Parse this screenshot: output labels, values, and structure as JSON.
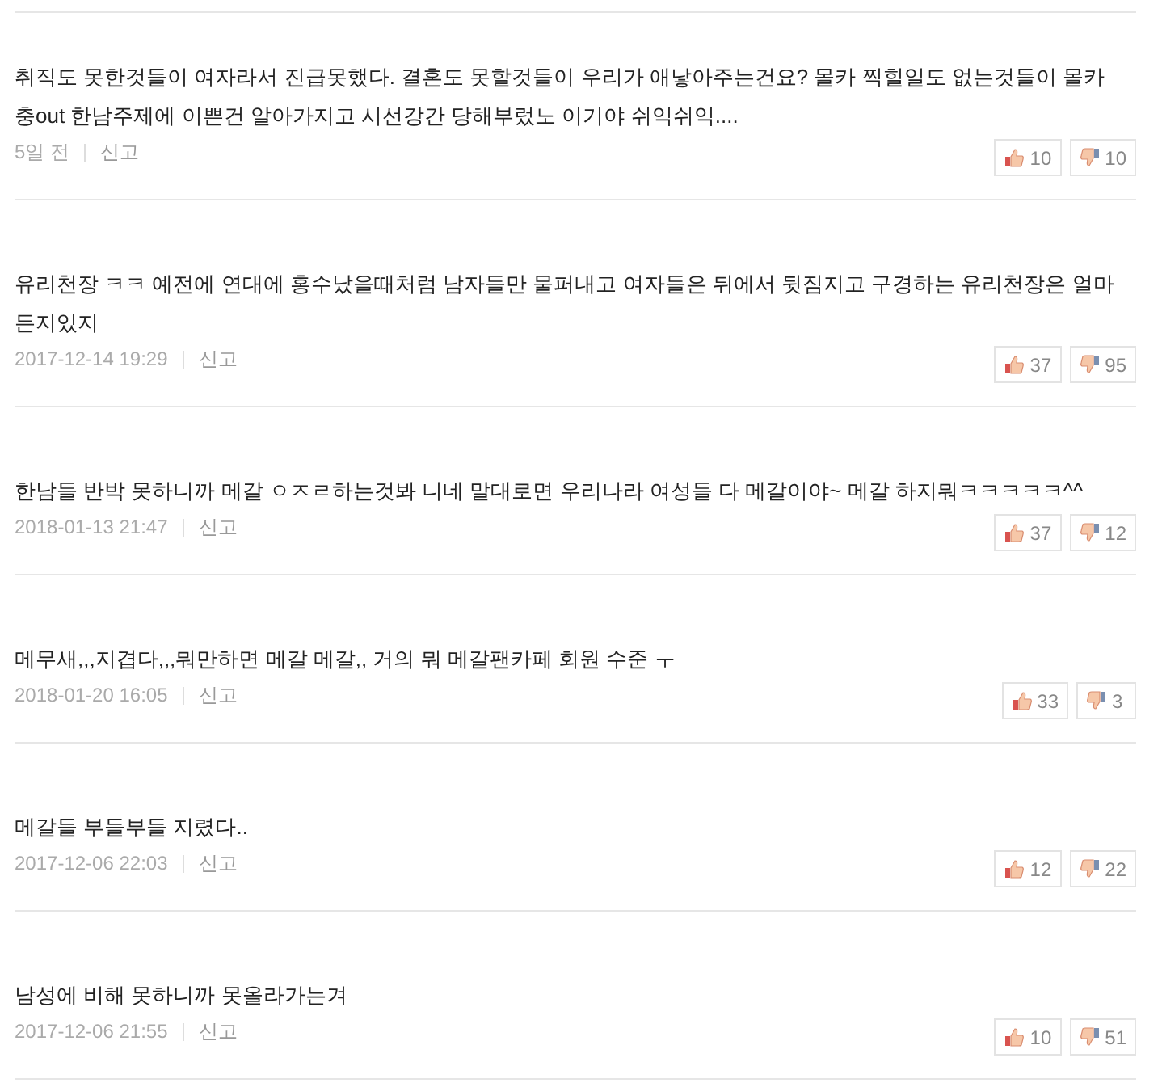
{
  "comments": [
    {
      "text": "취직도 못한것들이 여자라서 진급못했다. 결혼도 못할것들이 우리가 애낳아주는건요? 몰카 찍힐일도 없는것들이 몰카 충out 한남주제에 이쁜건 알아가지고 시선강간 당해부렀노 이기야 쉬익쉬익....",
      "time": "5일 전",
      "report": "신고",
      "likes": "10",
      "dislikes": "10"
    },
    {
      "text": "유리천장 ㅋㅋ 예전에 연대에 홍수났을때처럼 남자들만 물퍼내고 여자들은 뒤에서 뒷짐지고 구경하는 유리천장은 얼마든지있지",
      "time": "2017-12-14 19:29",
      "report": "신고",
      "likes": "37",
      "dislikes": "95"
    },
    {
      "text": "한남들 반박 못하니까 메갈 ㅇㅈㄹ하는것봐 니네 말대로면 우리나라 여성들 다 메갈이야~ 메갈 하지뭐ㅋㅋㅋㅋㅋ^^",
      "time": "2018-01-13 21:47",
      "report": "신고",
      "likes": "37",
      "dislikes": "12"
    },
    {
      "text": "메무새,,,지겹다,,,뭐만하면 메갈 메갈,, 거의 뭐 메갈팬카페 회원 수준 ㅜ",
      "time": "2018-01-20 16:05",
      "report": "신고",
      "likes": "33",
      "dislikes": "3"
    },
    {
      "text": "메갈들 부들부들 지렸다..",
      "time": "2017-12-06 22:03",
      "report": "신고",
      "likes": "12",
      "dislikes": "22"
    },
    {
      "text": "남성에 비해 못하니까 못올라가는겨",
      "time": "2017-12-06 21:55",
      "report": "신고",
      "likes": "10",
      "dislikes": "51"
    }
  ]
}
